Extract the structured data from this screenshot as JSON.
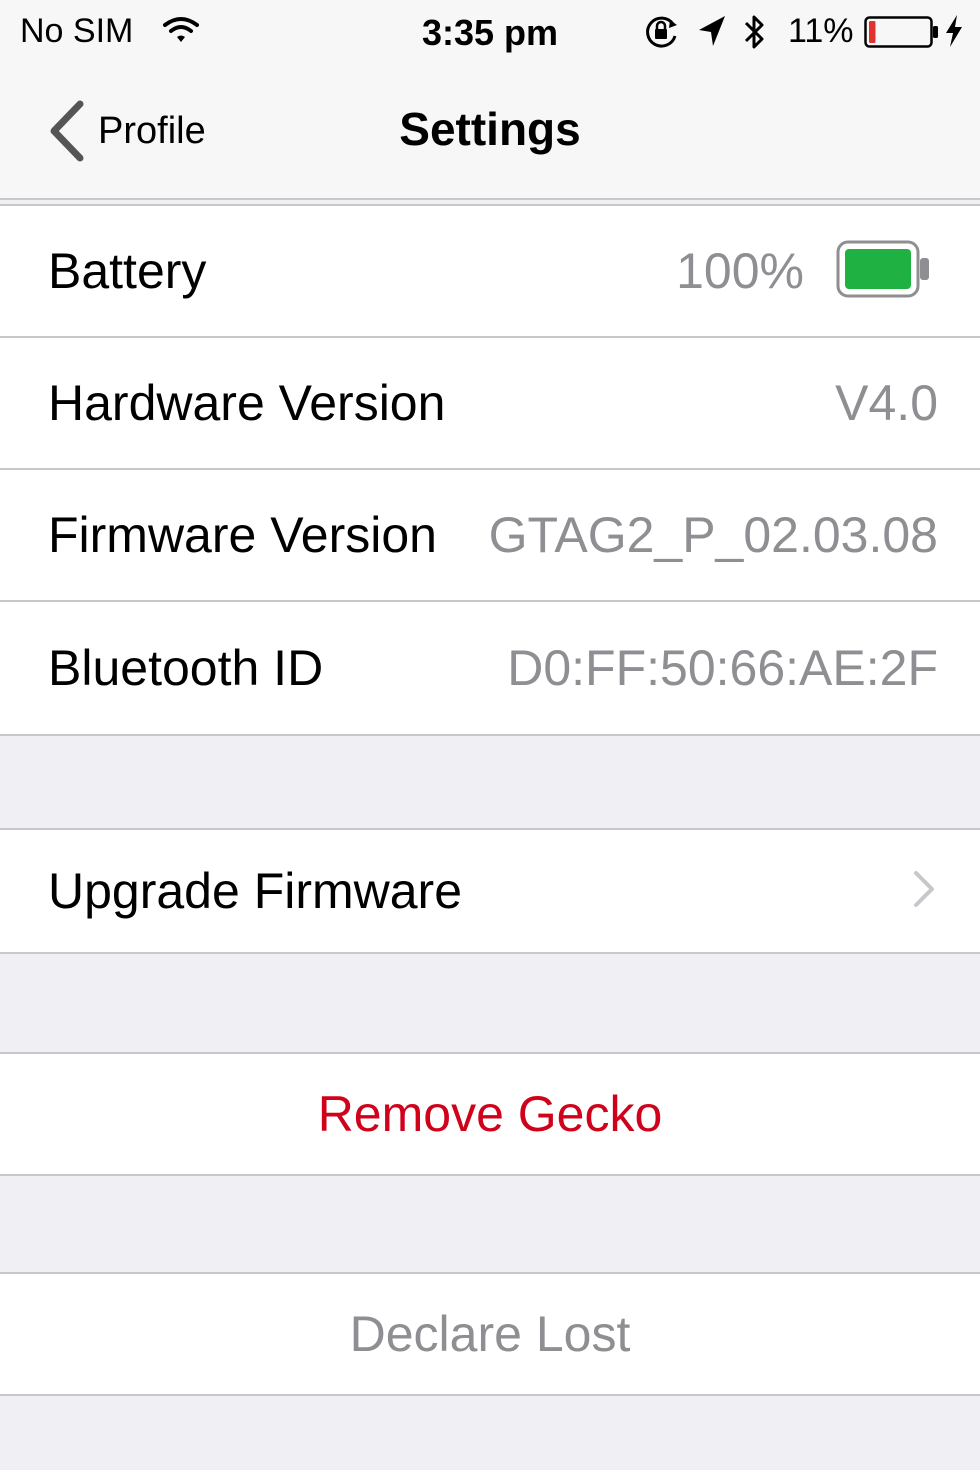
{
  "status_bar": {
    "carrier": "No SIM",
    "time": "3:35 pm",
    "battery_percent": "11%",
    "battery_level": 0.11,
    "icons": [
      "wifi-icon",
      "rotation-lock-icon",
      "location-arrow-icon",
      "bluetooth-icon",
      "battery-icon",
      "charging-bolt-icon"
    ]
  },
  "nav": {
    "back_label": "Profile",
    "title": "Settings"
  },
  "info": {
    "rows": [
      {
        "label": "Battery",
        "value": "100%",
        "level": 1.0
      },
      {
        "label": "Hardware Version",
        "value": "V4.0"
      },
      {
        "label": "Firmware Version",
        "value": "GTAG2_P_02.03.08"
      },
      {
        "label": "Bluetooth ID",
        "value": "D0:FF:50:66:AE:2F"
      }
    ]
  },
  "actions": {
    "upgrade_firmware": "Upgrade Firmware",
    "remove_gecko": "Remove Gecko",
    "declare_lost": "Declare Lost"
  },
  "colors": {
    "destructive": "#d0021b",
    "disabled": "#8e8e93",
    "battery_green": "#1fb141",
    "status_battery_red": "#e0322f"
  }
}
